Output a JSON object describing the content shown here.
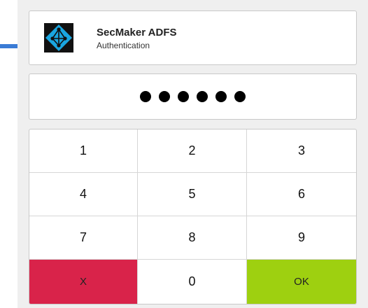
{
  "header": {
    "app_name": "SecMaker ADFS",
    "app_subtitle": "Authentication",
    "logo_icon": "adfs-network-logo-icon"
  },
  "pin": {
    "entered_count": 6
  },
  "keypad": {
    "keys": [
      "1",
      "2",
      "3",
      "4",
      "5",
      "6",
      "7",
      "8",
      "9"
    ],
    "cancel_label": "X",
    "zero_label": "0",
    "ok_label": "OK"
  },
  "colors": {
    "cancel": "#d9234a",
    "ok": "#9ed010",
    "logo_bg": "#111111",
    "logo_fg": "#1aa6e0"
  }
}
